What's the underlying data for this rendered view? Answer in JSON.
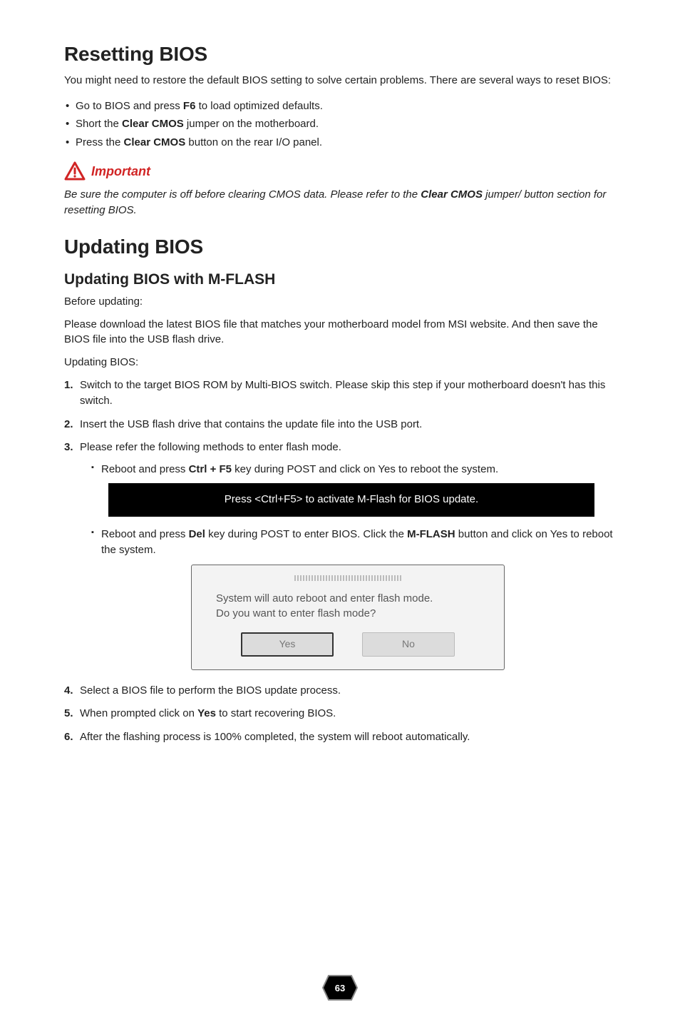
{
  "resetting": {
    "heading": "Resetting BIOS",
    "intro": "You might need to restore the default BIOS setting to solve certain problems. There are several ways to reset BIS:",
    "intro_full": "You might need to restore the default BIOS setting to solve certain problems. There are several ways to reset BIOS:",
    "bullets": [
      {
        "pre": "Go to BIOS and press ",
        "bold": "F6",
        "post": " to load optimized defaults."
      },
      {
        "pre": "Short the ",
        "bold": "Clear CMOS",
        "post": " jumper on the motherboard."
      },
      {
        "pre": "Press the ",
        "bold": "Clear CMOS",
        "post": " button on the rear I/O panel."
      }
    ]
  },
  "important": {
    "label": "Important",
    "text_pre": "Be sure the computer is off before clearing CMOS data. Please refer to the ",
    "text_bold": "Clear CMOS",
    "text_post": " jumper/ button section for resetting BIOS."
  },
  "updating": {
    "heading": "Updating BIOS",
    "mflash_heading": "Updating BIOS with M-FLASH",
    "before_label": "Before updating:",
    "before_text": "Please download the latest BIOS file that matches your motherboard model from MSI website. And then save the BIOS file into the USB flash drive.",
    "updating_label": "Updating BIOS:",
    "steps": {
      "s1": "Switch to the target BIOS ROM by Multi-BIOS switch. Please skip this step if your motherboard doesn't has this switch.",
      "s2": "Insert the USB flash drive that contains the update file into the USB port.",
      "s3": "Please refer the following methods to enter flash mode.",
      "s3a_pre": "Reboot and press ",
      "s3a_bold": "Ctrl + F5",
      "s3a_post": " key during POST and click on Yes to reboot the system.",
      "blackbar": "Press <Ctrl+F5> to activate M-Flash for BIOS update.",
      "s3b_pre": "Reboot and press ",
      "s3b_bold1": "Del",
      "s3b_mid": " key during POST to enter BIOS. Click the ",
      "s3b_bold2": "M-FLASH",
      "s3b_post": " button and click on Yes to reboot the system.",
      "dialog_line1": "System will auto reboot and enter flash mode.",
      "dialog_line2": "Do you want to enter flash mode?",
      "dialog_yes": "Yes",
      "dialog_no": "No",
      "s4": "Select a BIOS file to perform the BIOS update process.",
      "s5_pre": "When prompted click on ",
      "s5_bold": "Yes",
      "s5_post": " to start recovering BIOS.",
      "s6": "After the flashing process is 100% completed, the system will reboot automatically."
    }
  },
  "page_number": "63"
}
